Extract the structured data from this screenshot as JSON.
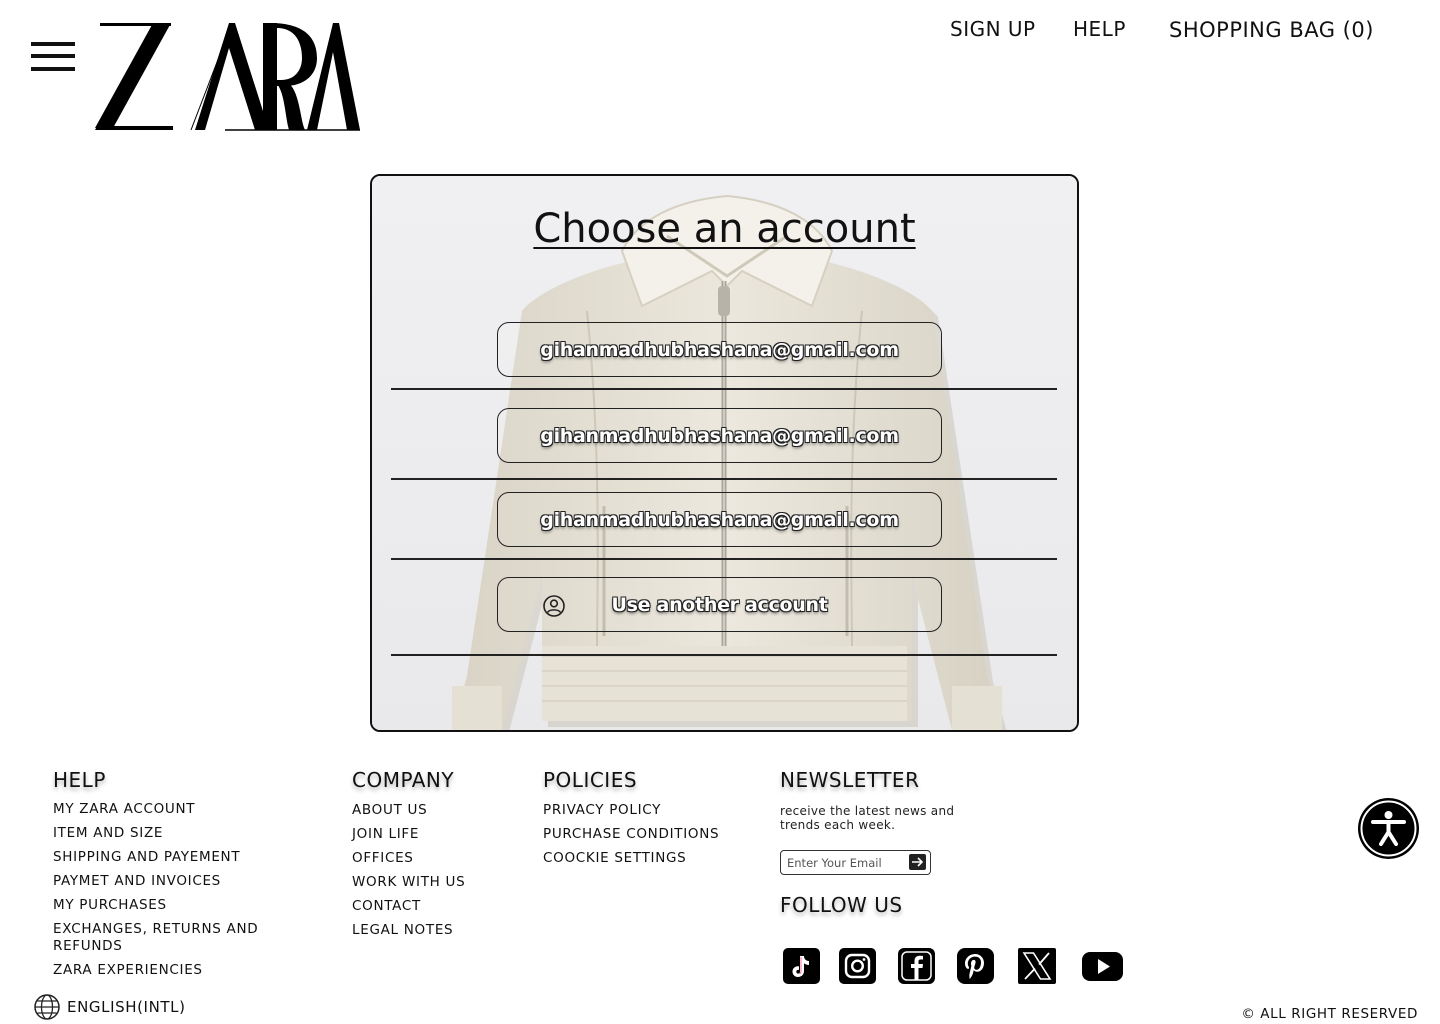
{
  "header": {
    "brand": "ZARA",
    "nav": {
      "sign_up": "SIGN UP",
      "help": "HELP",
      "bag": "SHOPPING BAG (0)"
    }
  },
  "account_chooser": {
    "title": "Choose an account",
    "accounts": [
      "gihanmadhubhashana@gmail.com",
      "gihanmadhubhashana@gmail.com",
      "gihanmadhubhashana@gmail.com"
    ],
    "other_account": "Use another account"
  },
  "footer": {
    "help": {
      "heading": "HELP",
      "links": [
        "MY ZARA ACCOUNT",
        "ITEM AND SIZE",
        "SHIPPING AND PAYEMENT",
        "PAYMET AND INVOICES",
        "MY PURCHASES",
        "EXCHANGES, RETURNS AND REFUNDS",
        "ZARA EXPERIENCIES"
      ]
    },
    "company": {
      "heading": "COMPANY",
      "links": [
        "ABOUT US",
        "JOIN LIFE",
        "OFFICES",
        "WORK WITH US",
        "CONTACT",
        "LEGAL NOTES"
      ]
    },
    "policies": {
      "heading": "POLICIES",
      "links": [
        "PRIVACY POLICY",
        "PURCHASE CONDITIONS",
        "COOCKIE SETTINGS"
      ]
    },
    "newsletter": {
      "heading": "NEWSLETTER",
      "description": "receive the latest news and trends each week.",
      "email_placeholder": "Enter Your Email"
    },
    "follow": {
      "heading": "FOLLOW US",
      "icons": [
        "tiktok-icon",
        "instagram-icon",
        "facebook-icon",
        "pinterest-icon",
        "x-icon",
        "youtube-icon"
      ]
    },
    "language": "ENGLISH(INTL)",
    "copyright": "© ALL RIGHT RESERVED"
  },
  "colors": {
    "text": "#111111",
    "card_background": "#ececee",
    "jacket": "#e6e2d6"
  }
}
